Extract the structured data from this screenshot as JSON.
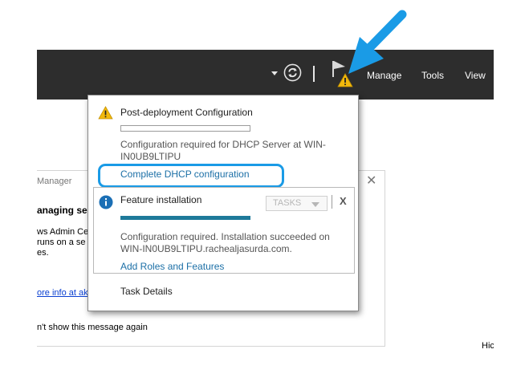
{
  "header": {
    "menu": {
      "manage": "Manage",
      "tools": "Tools",
      "view": "View"
    },
    "icons": [
      "dropdown-caret-icon",
      "refresh-icon",
      "notifications-flag-icon",
      "warning-icon"
    ]
  },
  "background": {
    "welcome_title": "Manager",
    "heading_fragment": "anaging se",
    "line1": "ws Admin Ce",
    "line2": " runs on a se",
    "line3": "es.",
    "link": "ore info at ak",
    "checkbox_text": "n't show this message again",
    "bottom_right": "Hic"
  },
  "popup": {
    "post_deploy": {
      "title": "Post-deployment Configuration",
      "message_line1": "Configuration required for DHCP Server at WIN-",
      "message_line2": "IN0UB9LTIPU",
      "link": "Complete DHCP configuration",
      "progress": 0
    },
    "feature": {
      "title": "Feature installation",
      "tasks_label": "TASKS",
      "close": "X",
      "message_line1": "Configuration required. Installation succeeded on",
      "message_line2": "WIN-IN0UB9LTIPU.rachealjasurda.com.",
      "link": "Add Roles and Features",
      "progress": 1.0
    },
    "task_details": "Task Details"
  },
  "colors": {
    "header_bg": "#2d2d2d",
    "accent_link": "#1b6fa6",
    "highlight": "#1a9be6",
    "progress_fill": "#1e7a9a",
    "warning": "#f2b90c",
    "info": "#1b6fb5"
  }
}
